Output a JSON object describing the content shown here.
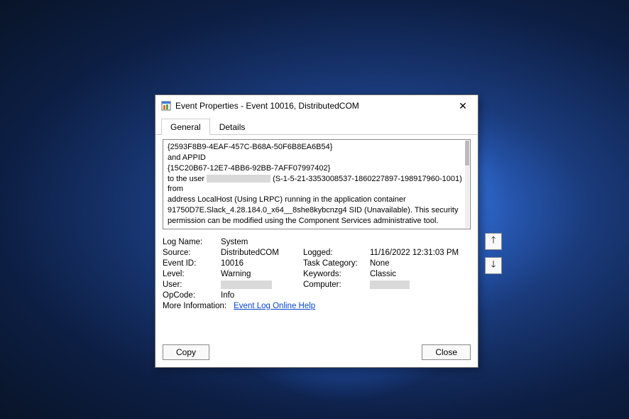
{
  "window": {
    "title": "Event Properties - Event 10016, DistributedCOM"
  },
  "tabs": {
    "general": "General",
    "details": "Details"
  },
  "description": {
    "line1": "{2593F8B9-4EAF-457C-B68A-50F6B8EA6B54}",
    "line2": " and APPID",
    "line3": "{15C20B67-12E7-4BB6-92BB-7AFF07997402}",
    "line4a": "to the user ",
    "line4b": " (S-1-5-21-3353008537-1860227897-198917960-1001) from",
    "line5": "address LocalHost (Using LRPC) running in the application container 91750D7E.Slack_4.28.184.0_x64__8she8kybcnzg4 SID (Unavailable). This security permission can be modified using the Component Services administrative tool."
  },
  "props": {
    "log_name_label": "Log Name:",
    "log_name": "System",
    "source_label": "Source:",
    "source": "DistributedCOM",
    "logged_label": "Logged:",
    "logged": "11/16/2022 12:31:03 PM",
    "event_id_label": "Event ID:",
    "event_id": "10016",
    "task_cat_label": "Task Category:",
    "task_cat": "None",
    "level_label": "Level:",
    "level": "Warning",
    "keywords_label": "Keywords:",
    "keywords": "Classic",
    "user_label": "User:",
    "computer_label": "Computer:",
    "opcode_label": "OpCode:",
    "opcode": "Info",
    "more_info_label": "More Information:",
    "more_info_link": "Event Log Online Help"
  },
  "buttons": {
    "copy": "Copy",
    "close": "Close"
  }
}
